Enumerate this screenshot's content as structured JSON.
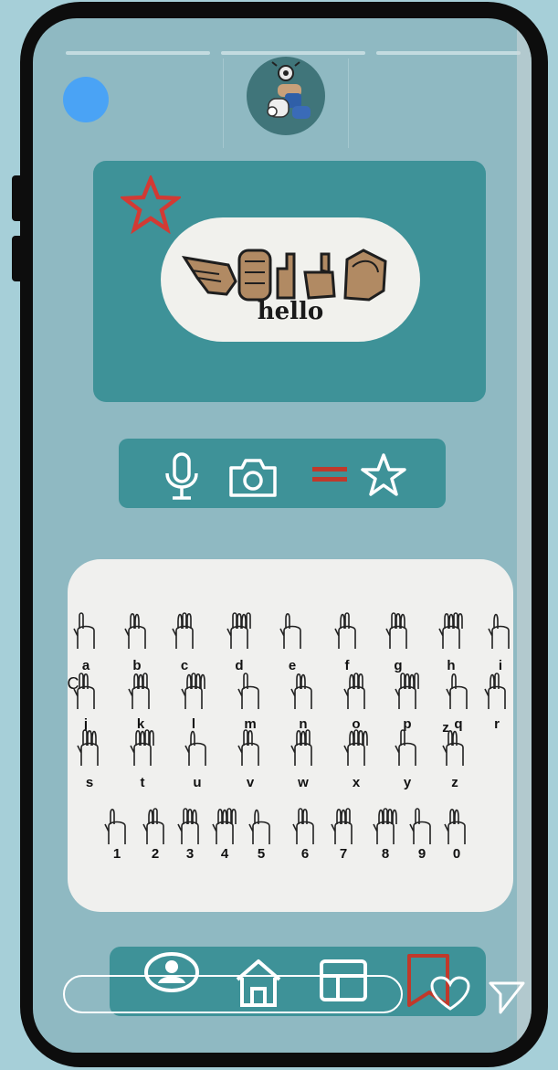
{
  "story": {
    "progress_segments": 3,
    "profile_icon": "sign-language-profile-picture",
    "status_dot_color": "#4aa3f5"
  },
  "sticker": {
    "favorite_icon": "star-outline-icon",
    "text": "hello"
  },
  "toolbar": {
    "icons": [
      "microphone-icon",
      "camera-icon",
      "equals-icon",
      "star-outline-icon"
    ]
  },
  "alphabet": {
    "rows": [
      [
        "a",
        "b",
        "c",
        "d",
        "e",
        "f",
        "g",
        "h",
        "i"
      ],
      [
        "j",
        "k",
        "l",
        "m",
        "n",
        "o",
        "p",
        "q",
        "r"
      ],
      [
        "s",
        "t",
        "u",
        "v",
        "w",
        "x",
        "y",
        "z"
      ]
    ],
    "z_prefix": "z",
    "j_prefix": "C",
    "numbers": [
      "1",
      "2",
      "3",
      "4",
      "5",
      "6",
      "7",
      "8",
      "9",
      "0"
    ]
  },
  "nav": {
    "icons": [
      "profile-icon",
      "home-icon",
      "layout-icon",
      "bookmark-icon"
    ],
    "active_color": "#c0392b"
  },
  "actions": {
    "like_icon": "heart-icon",
    "send_icon": "send-icon"
  }
}
